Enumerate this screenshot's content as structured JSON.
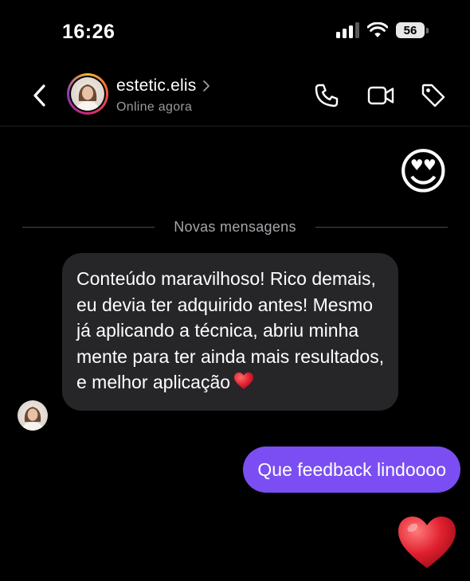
{
  "status_bar": {
    "time": "16:26",
    "battery": "56"
  },
  "header": {
    "name": "estetic.elis",
    "status": "Online agora",
    "actions": [
      "phone-icon",
      "video-camera-icon",
      "tag-icon"
    ]
  },
  "messages": {
    "reaction_emoji": "😍",
    "divider_label": "Novas mensagens",
    "received_text": "Conteúdo maravilhoso! Rico demais, eu devia ter adquirido antes! Mesmo já aplicando a técnica, abriu minha mente para ter ainda mais resultados, e melhor aplicação",
    "received_emoji": "heart-icon",
    "sent_text": "Que feedback lindoooo",
    "sent_reaction": "heart-icon"
  },
  "colors": {
    "background": "#000000",
    "received_bubble": "#262629",
    "sent_bubble": "#7a4ef2",
    "secondary_text": "#9a9aa0",
    "heart": "#e0202e"
  }
}
